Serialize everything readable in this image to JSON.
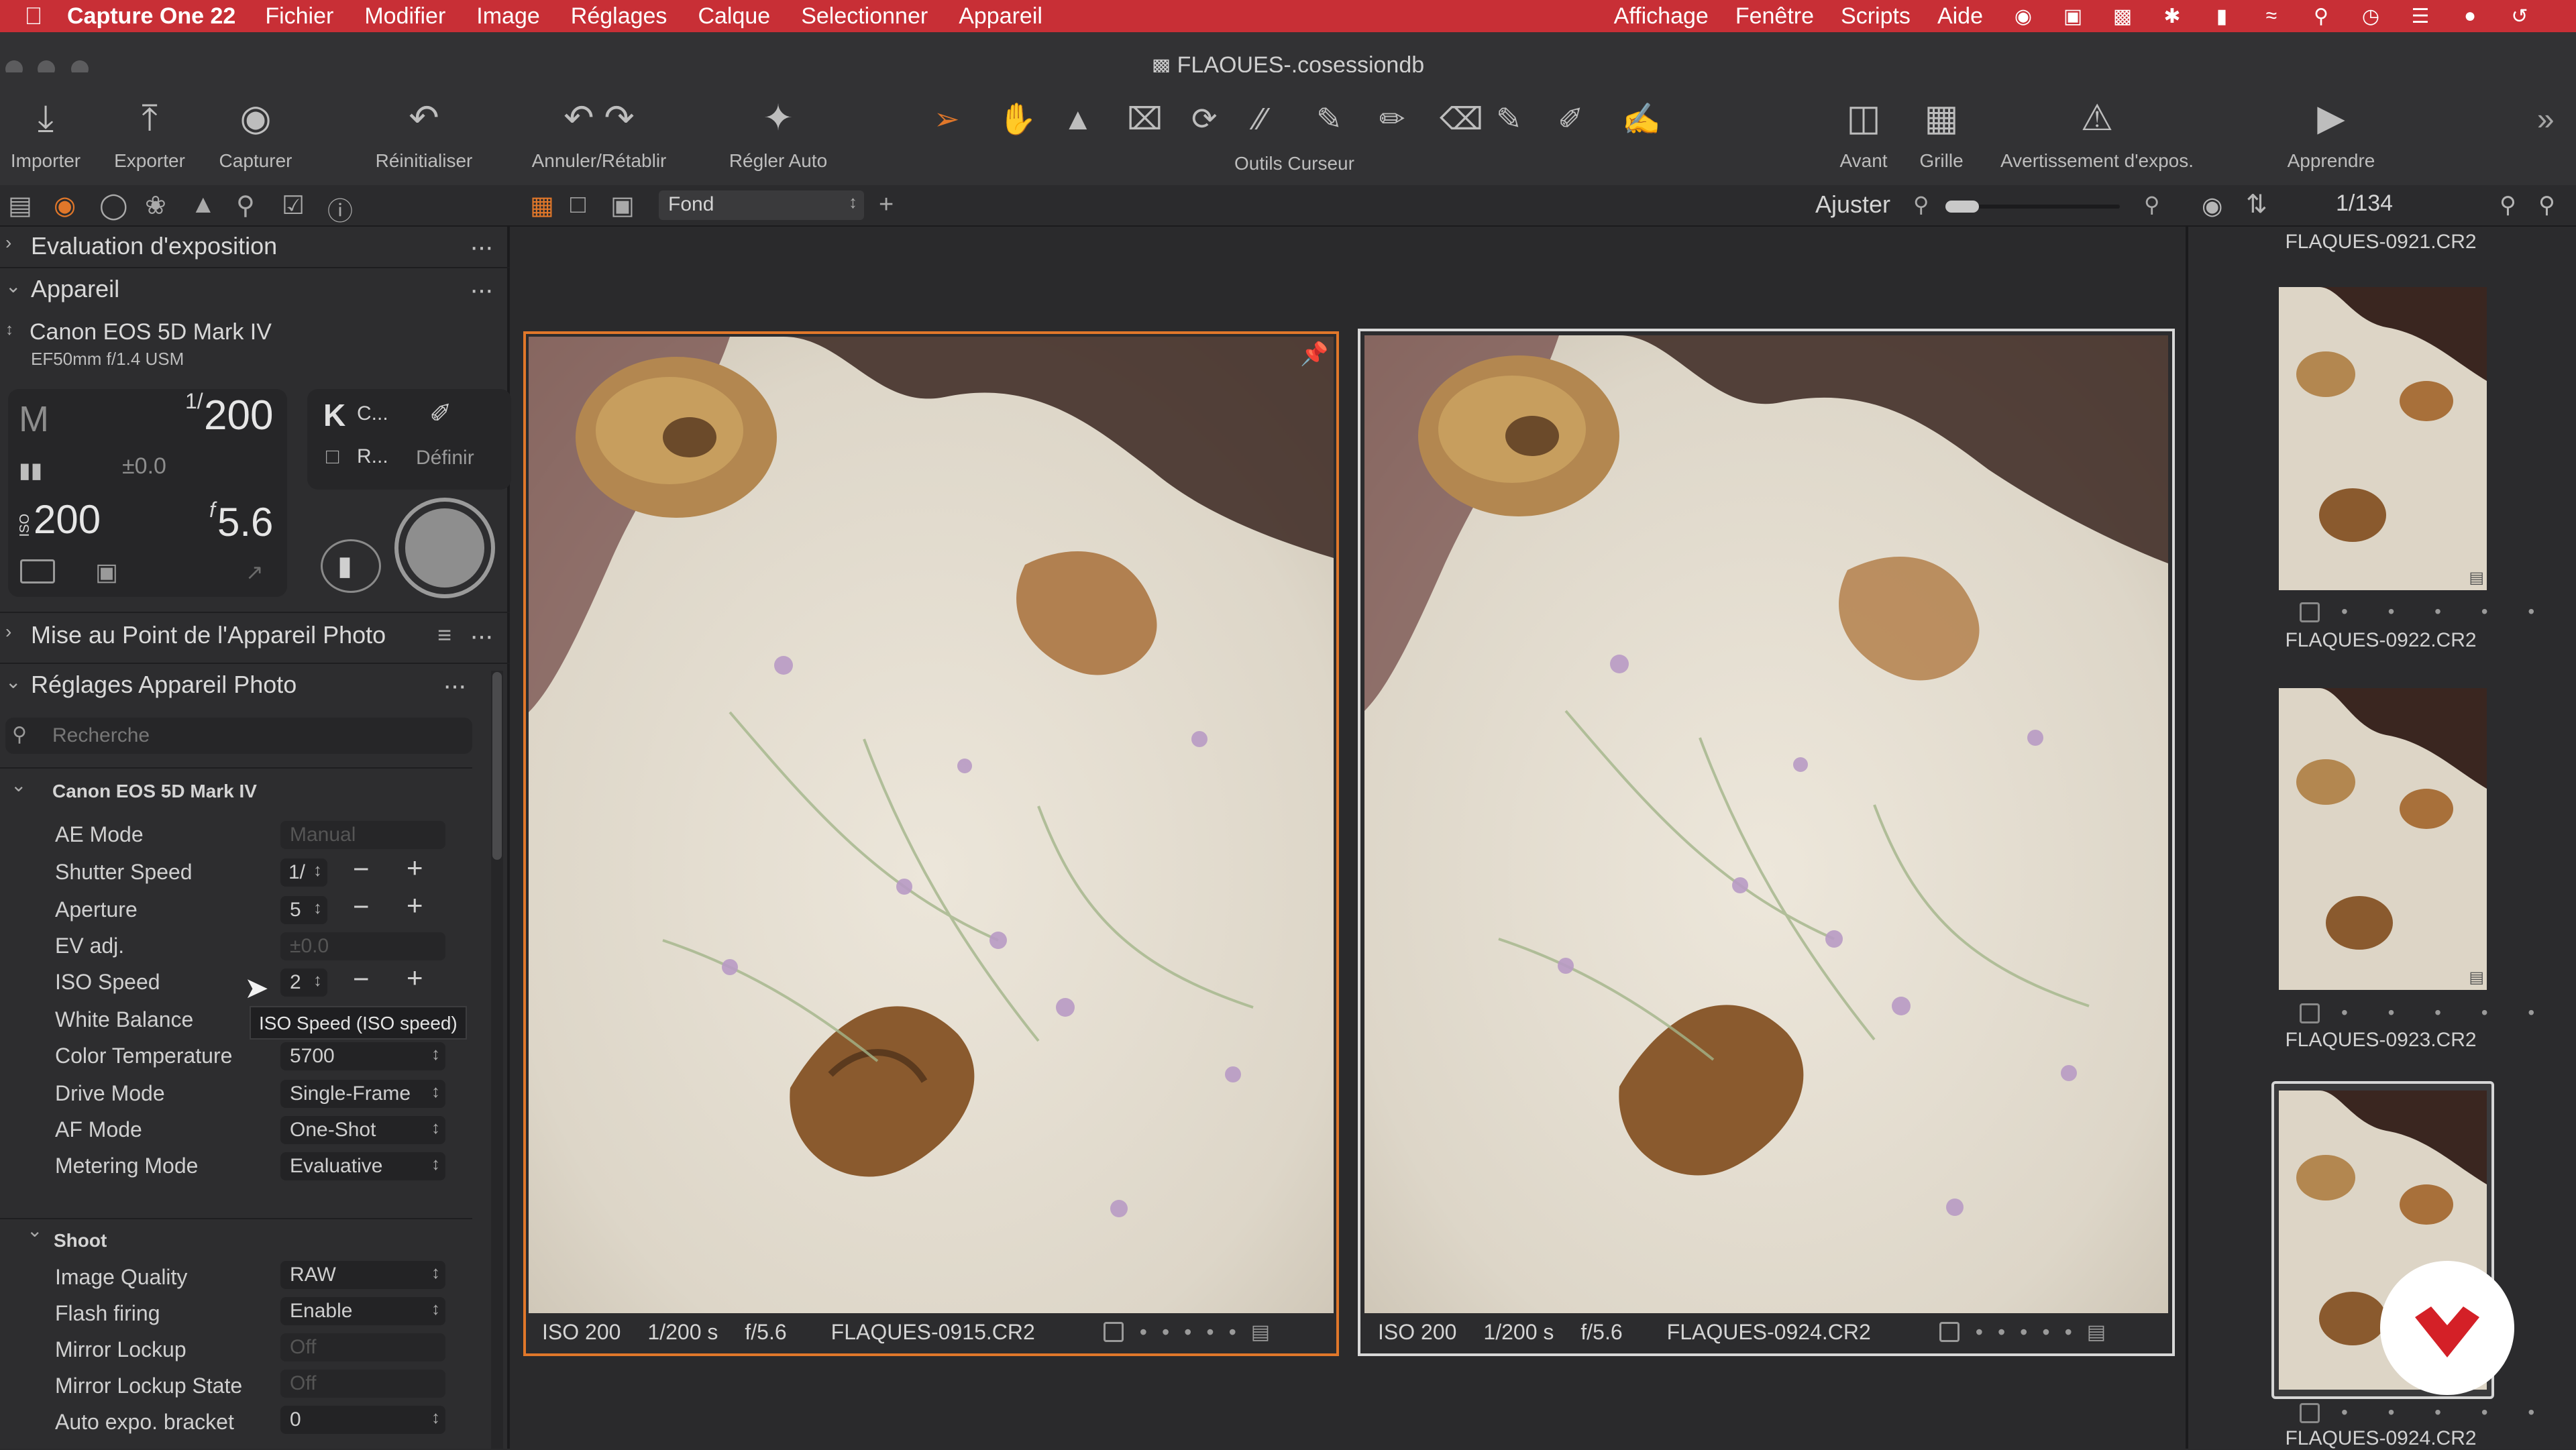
{
  "menubar": {
    "app_name": "Capture One 22",
    "items": [
      "Fichier",
      "Modifier",
      "Image",
      "Réglages",
      "Calque",
      "Selectionner",
      "Appareil"
    ],
    "right_items": [
      "Affichage",
      "Fenêtre",
      "Scripts",
      "Aide"
    ]
  },
  "window": {
    "title": "FLAQUES-.cosessiondb"
  },
  "toolbar": {
    "import": "Importer",
    "export": "Exporter",
    "capture": "Capturer",
    "reset": "Réinitialiser",
    "undo_redo": "Annuler/Rétablir",
    "auto_adjust": "Régler Auto",
    "cursor_tools": "Outils Curseur",
    "before": "Avant",
    "grid": "Grille",
    "exposure_warning": "Avertissement d'expos.",
    "learn": "Apprendre"
  },
  "subbar": {
    "background_select": "Fond",
    "fit_label": "Ajuster",
    "counter": "1/134"
  },
  "left_panel": {
    "exposure_eval": "Evaluation d'exposition",
    "camera_section": "Appareil",
    "camera_model": "Canon EOS 5D Mark IV",
    "lens": "EF50mm f/1.4 USM",
    "mode": "M",
    "shutter_num": "1/",
    "shutter_den": "200",
    "ev": "±0.0",
    "iso_prefix": "ISO",
    "iso": "200",
    "aperture_prefix": "f",
    "aperture": "5.6",
    "k_label": "K",
    "k_c": "C...",
    "k_r": "R...",
    "definir": "Définir",
    "focus_section": "Mise au Point de l'Appareil Photo",
    "settings_section": "Réglages Appareil Photo",
    "search_placeholder": "Recherche",
    "group_camera": "Canon EOS 5D Mark IV",
    "settings": [
      {
        "label": "AE Mode",
        "value": "Manual"
      },
      {
        "label": "Shutter Speed",
        "value": "1/"
      },
      {
        "label": "Aperture",
        "value": "5"
      },
      {
        "label": "EV adj.",
        "value": "±0.0"
      },
      {
        "label": "ISO Speed",
        "value": "2"
      },
      {
        "label": "White Balance",
        "value": ""
      },
      {
        "label": "Color Temperature",
        "value": "5700"
      },
      {
        "label": "Drive Mode",
        "value": "Single-Frame"
      },
      {
        "label": "AF Mode",
        "value": "One-Shot"
      },
      {
        "label": "Metering Mode",
        "value": "Evaluative"
      }
    ],
    "tooltip": "ISO Speed (ISO speed)",
    "group_shoot": "Shoot",
    "shoot": [
      {
        "label": "Image Quality",
        "value": "RAW"
      },
      {
        "label": "Flash firing",
        "value": "Enable"
      },
      {
        "label": "Mirror Lockup",
        "value": "Off"
      },
      {
        "label": "Mirror Lockup State",
        "value": "Off"
      },
      {
        "label": "Auto expo. bracket",
        "value": "0"
      }
    ]
  },
  "viewer": {
    "photos": [
      {
        "iso": "ISO 200",
        "shutter": "1/200 s",
        "aperture": "f/5.6",
        "file": "FLAQUES-0915.CR2"
      },
      {
        "iso": "ISO 200",
        "shutter": "1/200 s",
        "aperture": "f/5.6",
        "file": "FLAQUES-0924.CR2"
      }
    ]
  },
  "filmstrip": {
    "names": [
      "FLAQUES-0921.CR2",
      "FLAQUES-0922.CR2",
      "FLAQUES-0923.CR2",
      "FLAQUES-0924.CR2"
    ],
    "rating_dots": "• • • • •"
  },
  "colors": {
    "menubar": "#c82f36",
    "selection_orange": "#e0772a",
    "panel": "#2d2d2f",
    "viewer": "#2a2a2c"
  }
}
